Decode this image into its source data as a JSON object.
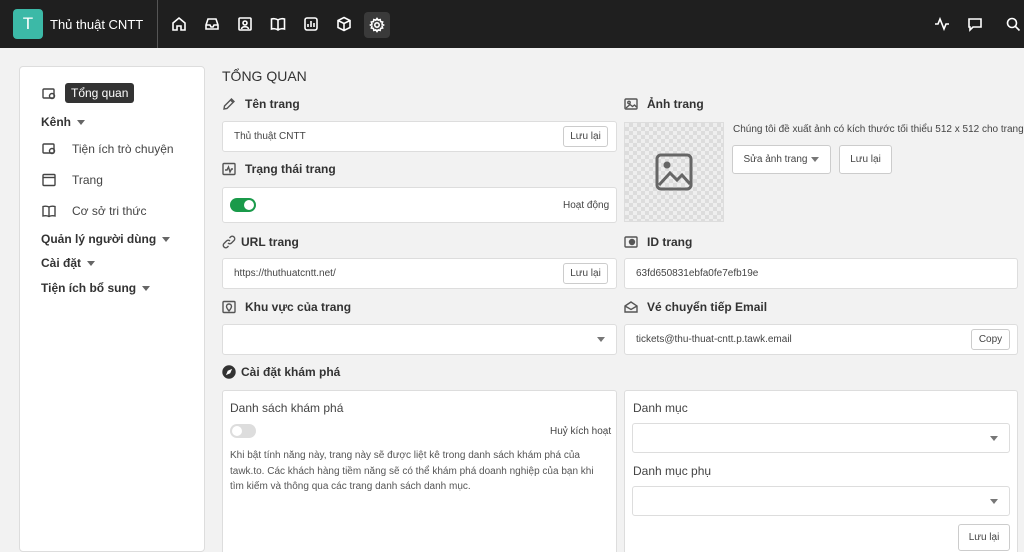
{
  "app": {
    "logo_letter": "T",
    "site_name": "Thủ thuật CNTT"
  },
  "topnav": {
    "icons": [
      "home-icon",
      "inbox-icon",
      "contacts-icon",
      "book-icon",
      "reports-icon",
      "box-icon",
      "settings-icon"
    ],
    "right_icons": [
      "activity-icon",
      "chat-icon",
      "search-icon"
    ]
  },
  "sidebar": {
    "tooltip": "Tổng quan",
    "channels": "Kênh",
    "chat_widget": "Tiện ích trò chuyện",
    "pages": "Trang",
    "knowledge_base": "Cơ sở tri thức",
    "user_management": "Quản lý người dùng",
    "settings": "Cài đặt",
    "addons": "Tiện ích bổ sung"
  },
  "main": {
    "title": "TỔNG QUAN",
    "page_name": {
      "label": "Tên trang",
      "value": "Thủ thuật CNTT",
      "save": "Lưu lại"
    },
    "page_status": {
      "label": "Trạng thái trang",
      "status": "Hoạt động",
      "enabled": true
    },
    "page_url": {
      "label": "URL trang",
      "value": "https://thuthuatcntt.net/",
      "save": "Lưu lại"
    },
    "page_region": {
      "label": "Khu vực của trang",
      "value": ""
    },
    "page_image": {
      "label": "Ảnh trang",
      "hint": "Chúng tôi đề xuất ảnh có kích thước tối thiểu 512 x 512 cho trang.",
      "edit": "Sửa ảnh trang",
      "save": "Lưu lại"
    },
    "page_id": {
      "label": "ID trang",
      "value": "63fd650831ebfa0fe7efb19e"
    },
    "email_forward": {
      "label": "Vé chuyển tiếp Email",
      "value": "tickets@thu-thuat-cntt.p.tawk.email",
      "copy": "Copy"
    },
    "discovery": {
      "label": "Cài đặt khám phá",
      "list_title": "Danh sách khám phá",
      "status": "Huỷ kích hoạt",
      "enabled": false,
      "description": "Khi bật tính năng này, trang này sẽ được liệt kê trong danh sách khám phá của tawk.to. Các khách hàng tiềm năng sẽ có thể khám phá doanh nghiệp của bạn khi tìm kiếm và thông qua các trang danh sách danh mục.",
      "category_label": "Danh mục",
      "subcategory_label": "Danh mục phụ",
      "save": "Lưu lại"
    }
  },
  "colors": {
    "topbar": "#1f1f1f",
    "logo": "#3cb9a7",
    "toggle_on": "#1a9a4a"
  }
}
